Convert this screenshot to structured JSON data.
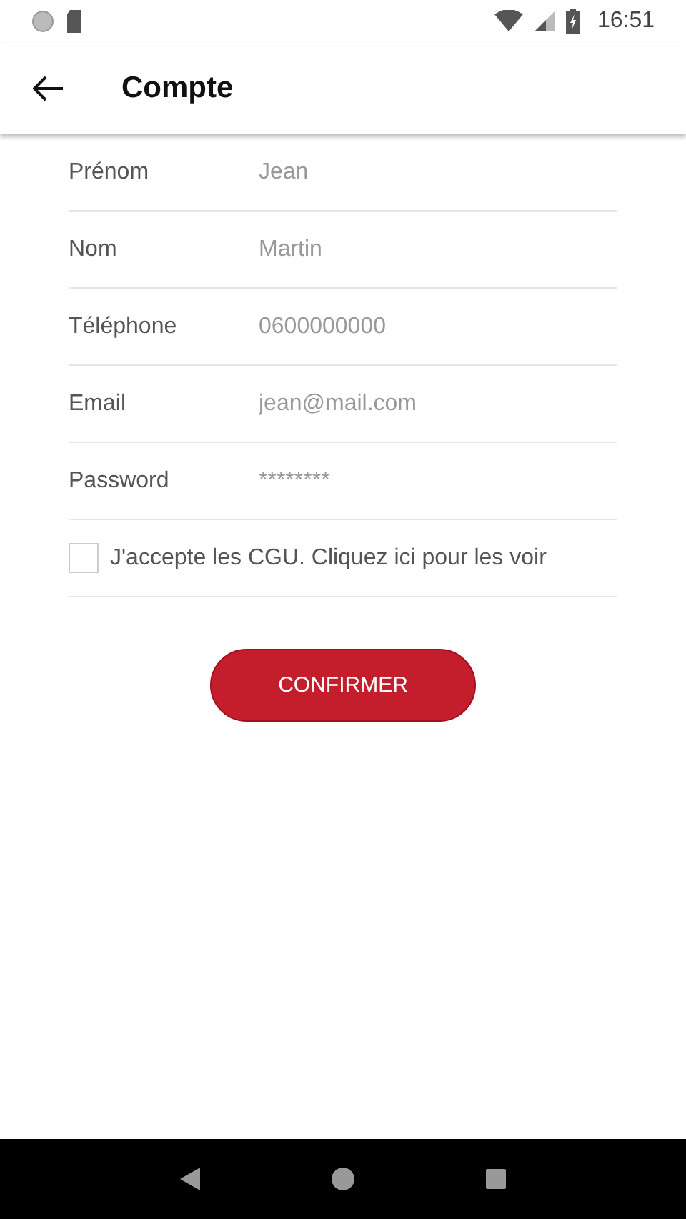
{
  "status_bar": {
    "time": "16:51"
  },
  "app_bar": {
    "title": "Compte"
  },
  "fields": [
    {
      "label": "Prénom",
      "value": "Jean"
    },
    {
      "label": "Nom",
      "value": "Martin"
    },
    {
      "label": "Téléphone",
      "value": "0600000000"
    },
    {
      "label": "Email",
      "value": "jean@mail.com"
    },
    {
      "label": "Password",
      "value": "********"
    }
  ],
  "terms": {
    "label": "J'accepte les CGU. Cliquez ici pour les voir",
    "checked": false
  },
  "confirm_button": "CONFIRMER"
}
